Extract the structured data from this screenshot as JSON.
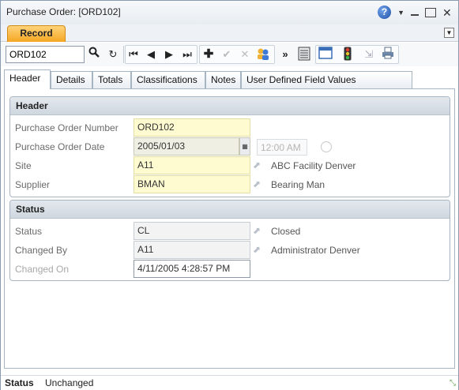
{
  "window": {
    "title": "Purchase Order: [ORD102]"
  },
  "tabstrip": {
    "record_tab": "Record"
  },
  "toolbar": {
    "search_value": "ORD102"
  },
  "tabs": [
    "Header",
    "Details",
    "Totals",
    "Classifications",
    "Notes",
    "User Defined Field Values"
  ],
  "header_section": {
    "title": "Header",
    "po_number_label": "Purchase Order Number",
    "po_number_value": "ORD102",
    "po_date_label": "Purchase Order Date",
    "po_date_value": "2005/01/03",
    "po_time_value": "12:00 AM",
    "site_label": "Site",
    "site_value": "A11",
    "site_desc": "ABC Facility Denver",
    "supplier_label": "Supplier",
    "supplier_value": "BMAN",
    "supplier_desc": "Bearing Man"
  },
  "status_section": {
    "title": "Status",
    "status_label": "Status",
    "status_value": "CL",
    "status_desc": "Closed",
    "changed_by_label": "Changed By",
    "changed_by_value": "A11",
    "changed_by_desc": "Administrator Denver",
    "changed_on_label": "Changed On",
    "changed_on_value": "4/11/2005 4:28:57 PM"
  },
  "statusbar": {
    "label": "Status",
    "value": "Unchanged"
  },
  "colors": {
    "record_tab": "#f5a623",
    "required_field": "#fffbd0",
    "section_header": "#cfd7df"
  },
  "icons": [
    "help-icon",
    "search-icon",
    "refresh-icon",
    "first-record-icon",
    "prev-record-icon",
    "next-record-icon",
    "last-record-icon",
    "add-icon",
    "save-check-icon",
    "delete-x-icon",
    "users-icon",
    "more-icon",
    "list-view-icon",
    "window-icon",
    "traffic-light-icon",
    "export-icon",
    "print-icon"
  ]
}
